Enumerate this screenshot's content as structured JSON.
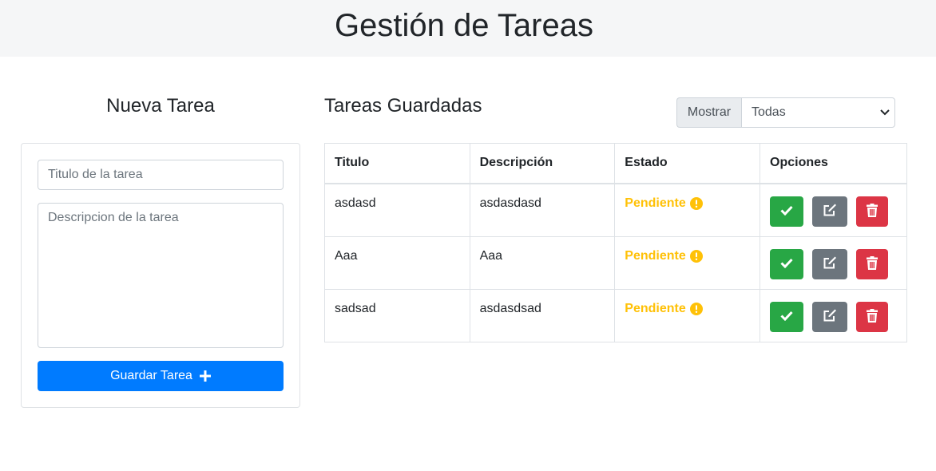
{
  "header": {
    "title": "Gestión de Tareas"
  },
  "form": {
    "heading": "Nueva Tarea",
    "title_placeholder": "Titulo de la tarea",
    "description_placeholder": "Descripcion de la tarea",
    "save_label": "Guardar Tarea"
  },
  "list": {
    "heading": "Tareas Guardadas",
    "filter_label": "Mostrar",
    "filter_value": "Todas",
    "columns": [
      "Titulo",
      "Descripción",
      "Estado",
      "Opciones"
    ],
    "rows": [
      {
        "title": "asdasd",
        "description": "asdasdasd",
        "status": "Pendiente"
      },
      {
        "title": "Aaa",
        "description": "Aaa",
        "status": "Pendiente"
      },
      {
        "title": "sadsad",
        "description": "asdasdsad",
        "status": "Pendiente"
      }
    ]
  },
  "colors": {
    "primary": "#007bff",
    "success": "#28a745",
    "secondary": "#6c757d",
    "danger": "#dc3545",
    "warning": "#ffc107"
  },
  "icons": {
    "save": "plus-icon",
    "status": "exclamation-circle-icon",
    "complete": "check-icon",
    "edit": "edit-icon",
    "delete": "trash-icon",
    "filter": "chevron-down-icon"
  }
}
